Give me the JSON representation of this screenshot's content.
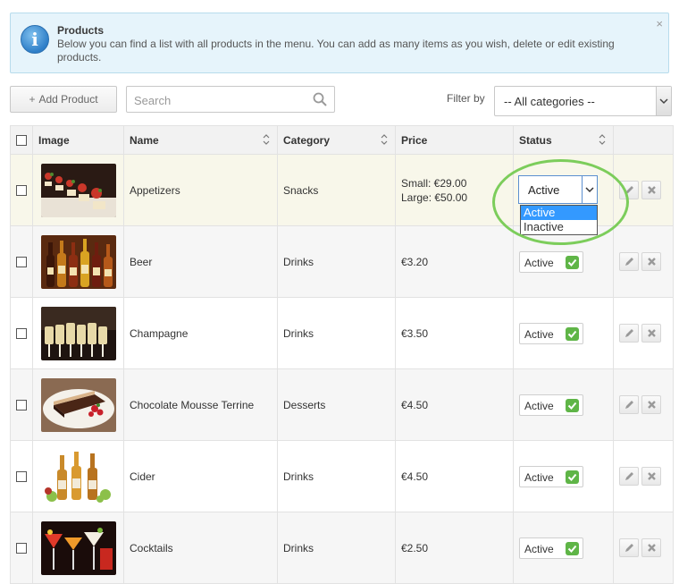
{
  "info": {
    "title": "Products",
    "text": "Below you can find a list with all products in the menu. You can add as many items as you wish, delete or edit existing products.",
    "icon": "info-icon",
    "close": "×"
  },
  "toolbar": {
    "add_label": "Add Product",
    "add_icon": "+",
    "search_placeholder": "Search",
    "filter_label": "Filter by",
    "filter_value": "-- All categories --"
  },
  "table": {
    "headers": {
      "image": "Image",
      "name": "Name",
      "category": "Category",
      "price": "Price",
      "status": "Status"
    },
    "rows": [
      {
        "name": "Appetizers",
        "category": "Snacks",
        "price_lines": [
          "Small: €29.00",
          "Large: €50.00"
        ],
        "status": "Active",
        "image": "appetizers-photo"
      },
      {
        "name": "Beer",
        "category": "Drinks",
        "price": "€3.20",
        "status": "Active",
        "image": "beer-bottles-photo"
      },
      {
        "name": "Champagne",
        "category": "Drinks",
        "price": "€3.50",
        "status": "Active",
        "image": "champagne-glasses-photo"
      },
      {
        "name": "Chocolate Mousse Terrine",
        "category": "Desserts",
        "price": "€4.50",
        "status": "Active",
        "image": "chocolate-terrine-photo"
      },
      {
        "name": "Cider",
        "category": "Drinks",
        "price": "€4.50",
        "status": "Active",
        "image": "cider-bottles-photo"
      },
      {
        "name": "Cocktails",
        "category": "Drinks",
        "price": "€2.50",
        "status": "Active",
        "image": "cocktails-photo"
      }
    ]
  },
  "status_dropdown": {
    "value": "Active",
    "options": [
      "Active",
      "Inactive"
    ],
    "selected_index": 0
  },
  "colors": {
    "accent_green": "#5fb547",
    "info_bg": "#e6f4fb",
    "highlight_ring": "#7ccd5b",
    "selected_option": "#3399ff"
  }
}
